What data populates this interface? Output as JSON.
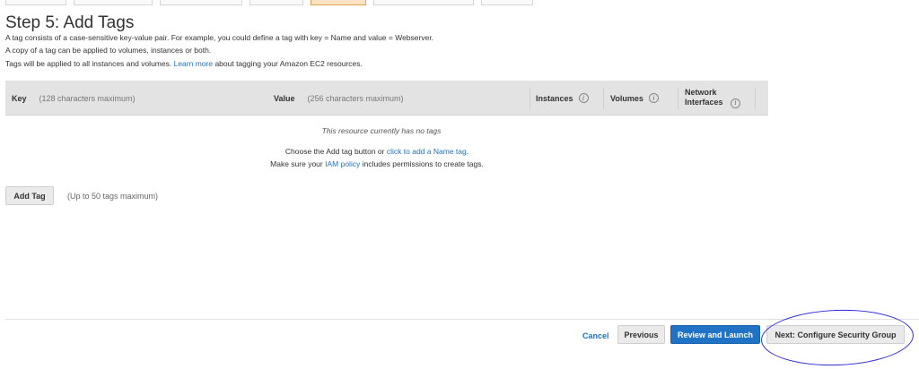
{
  "wizard": {
    "title": "Step 5: Add Tags",
    "description": {
      "line1": "A tag consists of a case-sensitive key-value pair. For example, you could define a tag with key = Name and value = Webserver.",
      "line2": "A copy of a tag can be applied to volumes, instances or both.",
      "line3_prefix": "Tags will be applied to all instances and volumes.",
      "line3_link": "Learn more",
      "line3_suffix": "about tagging your Amazon EC2 resources."
    }
  },
  "table": {
    "key_label": "Key",
    "key_hint": "(128 characters maximum)",
    "value_label": "Value",
    "value_hint": "(256 characters maximum)",
    "instances_label": "Instances",
    "volumes_label": "Volumes",
    "network_label_line1": "Network",
    "network_label_line2": "Interfaces",
    "info_glyph": "i",
    "empty_message": "This resource currently has no tags",
    "hint1_prefix": "Choose the Add tag button or",
    "hint1_link": "click to add a Name tag",
    "hint1_suffix": ".",
    "hint2_prefix": "Make sure your",
    "hint2_link": "IAM policy",
    "hint2_suffix": "includes permissions to create tags."
  },
  "add_tag": {
    "button_label": "Add Tag",
    "limit_text": "(Up to 50 tags maximum)"
  },
  "footer": {
    "cancel_label": "Cancel",
    "previous_label": "Previous",
    "review_label": "Review and Launch",
    "next_label": "Next: Configure Security Group"
  },
  "colors": {
    "link_blue": "#1f72c4",
    "primary_button": "#1f72c4",
    "active_step_tab": "#fbe3c4",
    "annotation_ink": "#2a2ad8"
  }
}
